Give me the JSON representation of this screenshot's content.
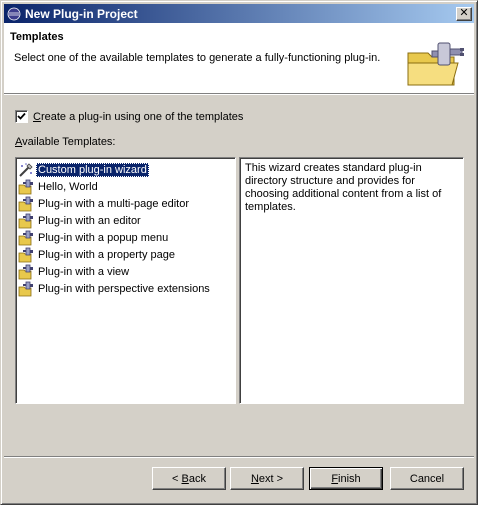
{
  "window": {
    "title": "New Plug-in Project",
    "close_label": "✕"
  },
  "header": {
    "title": "Templates",
    "description": "Select one of the available templates to generate a fully-functioning plug-in."
  },
  "options": {
    "use_template": {
      "checked": true,
      "label_accel": "C",
      "label_rest": "reate a plug-in using one of the templates"
    }
  },
  "templates": {
    "label_accel": "A",
    "label_rest": "vailable Templates:",
    "items": [
      {
        "label": "Custom plug-in wizard",
        "icon": "custom-wizard-icon",
        "selected": true
      },
      {
        "label": "Hello, World",
        "icon": "plugin-template-icon",
        "selected": false
      },
      {
        "label": "Plug-in with a multi-page editor",
        "icon": "plugin-template-icon",
        "selected": false
      },
      {
        "label": "Plug-in with an editor",
        "icon": "plugin-template-icon",
        "selected": false
      },
      {
        "label": "Plug-in with a popup menu",
        "icon": "plugin-template-icon",
        "selected": false
      },
      {
        "label": "Plug-in with a property page",
        "icon": "plugin-template-icon",
        "selected": false
      },
      {
        "label": "Plug-in with a view",
        "icon": "plugin-template-icon",
        "selected": false
      },
      {
        "label": "Plug-in with perspective extensions",
        "icon": "plugin-template-icon",
        "selected": false
      }
    ]
  },
  "description_text": "This wizard creates standard plug-in directory structure and provides for choosing additional content from a list of templates.",
  "buttons": {
    "back": {
      "prefix": "< ",
      "accel": "B",
      "rest": "ack"
    },
    "next": {
      "prefix": "",
      "accel": "N",
      "rest": "ext >"
    },
    "finish": {
      "prefix": "",
      "accel": "F",
      "rest": "inish"
    },
    "cancel": {
      "label": "Cancel"
    }
  }
}
